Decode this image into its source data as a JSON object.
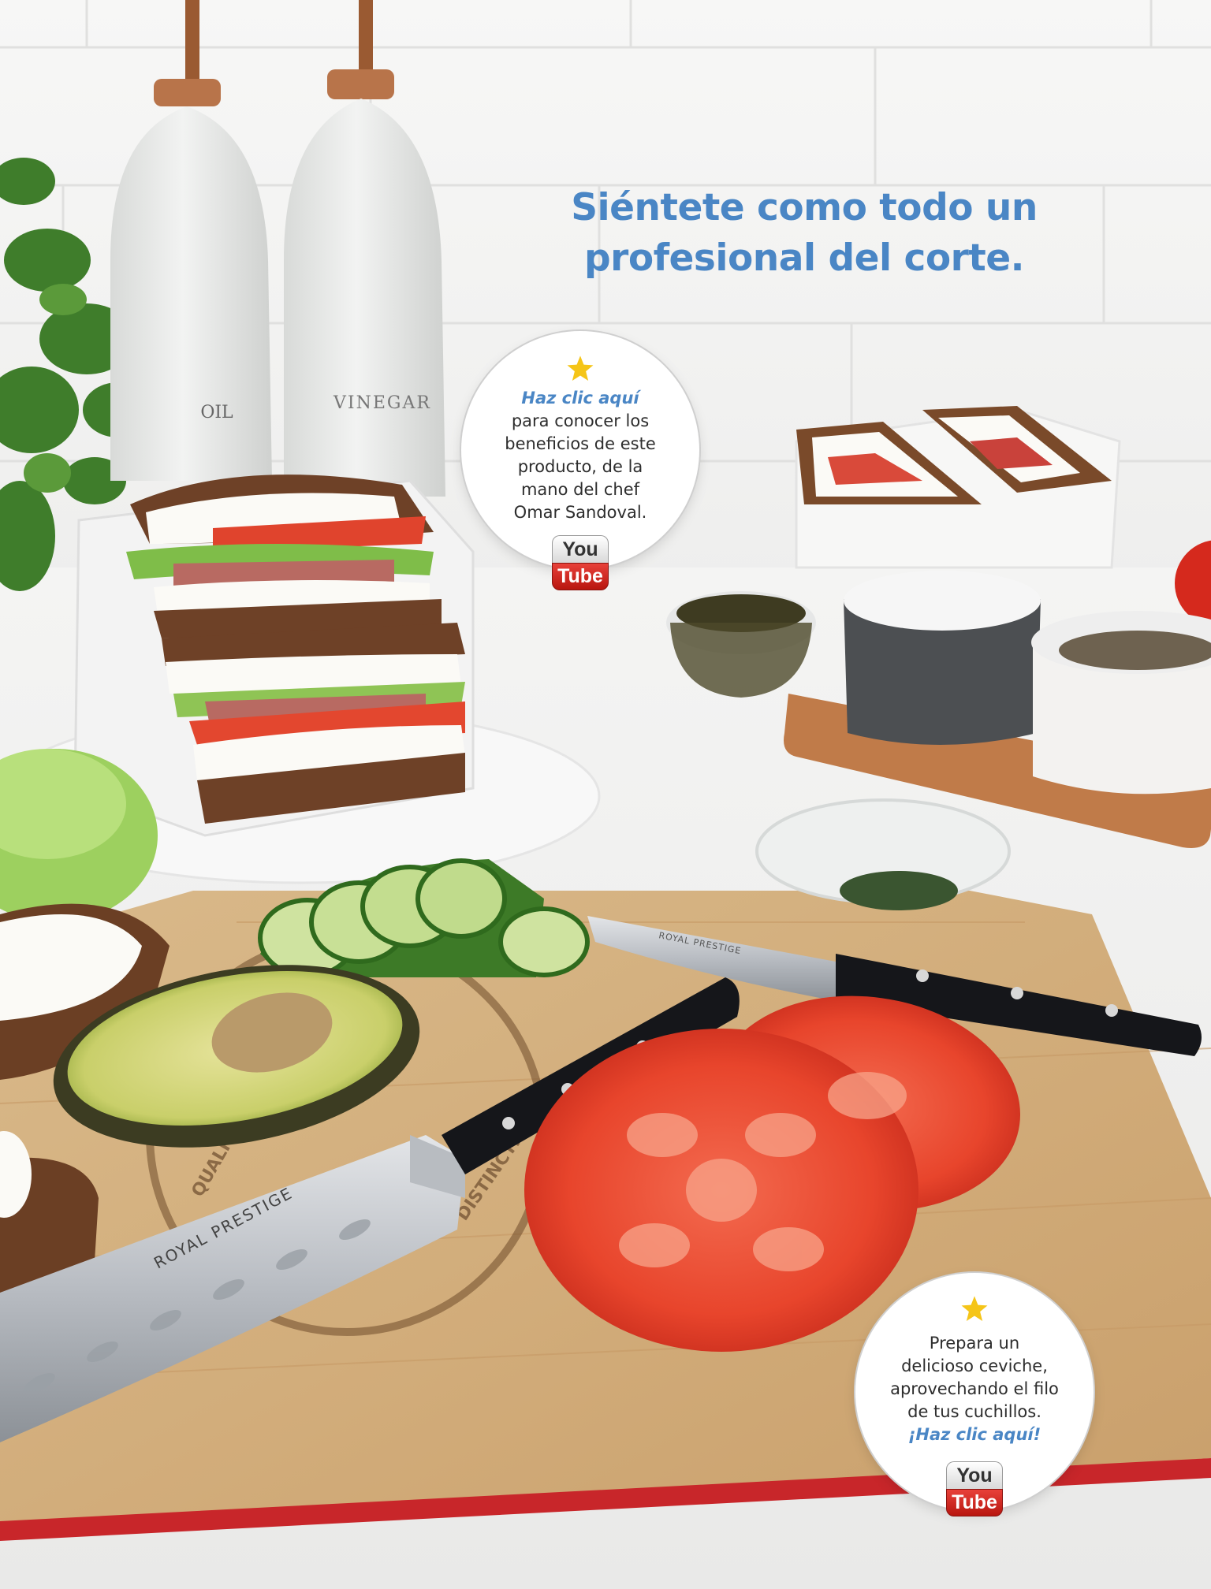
{
  "headline": {
    "line1": "Siéntete como todo un",
    "line2": "profesional del corte."
  },
  "callout_1": {
    "icon": "star-icon",
    "link_text": "Haz clic aquí",
    "lines": [
      "para conocer los",
      "beneficios de este",
      "producto, de la",
      "mano del chef",
      "Omar Sandoval."
    ],
    "youtube": {
      "top": "You",
      "bottom": "Tube"
    }
  },
  "callout_2": {
    "icon": "star-icon",
    "lines": [
      "Prepara un",
      "delicioso ceviche,",
      "aprovechando el filo",
      "de tus cuchillos."
    ],
    "link_text": "¡Haz clic aquí!",
    "youtube": {
      "top": "You",
      "bottom": "Tube"
    }
  },
  "scene": {
    "bottle_labels": [
      "OIL",
      "VINEGAR"
    ],
    "knife_brand": "ROYAL PRESTIGE",
    "board_text": [
      "QUALITY",
      "DISTINCTION"
    ]
  },
  "colors": {
    "headline": "#4a86c5",
    "star": "#f5c518",
    "youtube_red": "#d52b22",
    "board_red_edge": "#c8262a"
  }
}
